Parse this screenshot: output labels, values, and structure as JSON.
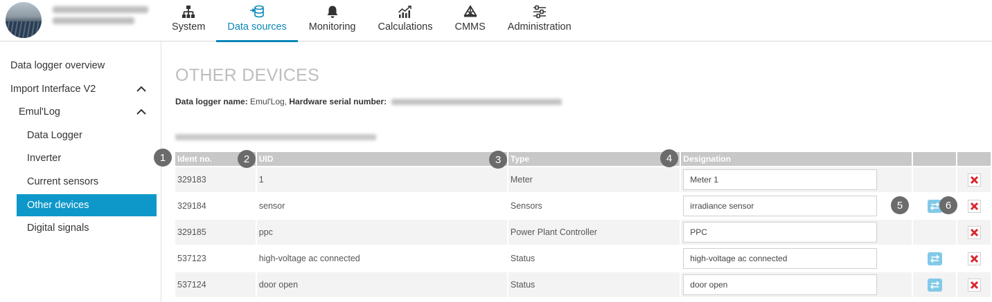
{
  "header": {
    "nav": [
      {
        "label": "System",
        "icon": "sitemap-icon"
      },
      {
        "label": "Data sources",
        "icon": "data-sources-icon",
        "active": true
      },
      {
        "label": "Monitoring",
        "icon": "bell-icon"
      },
      {
        "label": "Calculations",
        "icon": "chart-icon"
      },
      {
        "label": "CMMS",
        "icon": "tools-icon"
      },
      {
        "label": "Administration",
        "icon": "sliders-icon"
      }
    ]
  },
  "sidebar": {
    "items": [
      {
        "label": "Data logger overview"
      },
      {
        "label": "Import Interface V2",
        "expanded": true
      },
      {
        "label": "Emul'Log",
        "expanded": true
      },
      {
        "label": "Data Logger"
      },
      {
        "label": "Inverter"
      },
      {
        "label": "Current sensors"
      },
      {
        "label": "Other devices",
        "active": true
      },
      {
        "label": "Digital signals"
      }
    ]
  },
  "main": {
    "title": "OTHER DEVICES",
    "logger_name_label": "Data logger name:",
    "logger_name": "Emul'Log,",
    "serial_label": "Hardware serial number:",
    "table": {
      "columns": [
        "Ident no.",
        "UID",
        "Type",
        "Designation"
      ],
      "rows": [
        {
          "ident": "329183",
          "uid": "1",
          "type": "Meter",
          "designation": "Meter 1",
          "swap": false
        },
        {
          "ident": "329184",
          "uid": "sensor",
          "type": "Sensors",
          "designation": "irradiance sensor",
          "swap": true
        },
        {
          "ident": "329185",
          "uid": "ppc",
          "type": "Power Plant Controller",
          "designation": "PPC",
          "swap": false
        },
        {
          "ident": "537123",
          "uid": "high-voltage ac connected",
          "type": "Status",
          "designation": "high-voltage ac connected",
          "swap": true
        },
        {
          "ident": "537124",
          "uid": "door open",
          "type": "Status",
          "designation": "door open",
          "swap": true
        }
      ]
    }
  },
  "callouts": [
    "1",
    "2",
    "3",
    "4",
    "5",
    "6"
  ],
  "colors": {
    "accent": "#0a86b8",
    "sidebar_active": "#0e98c9",
    "header_gray": "#c8c8c8",
    "delete_red": "#d9262c",
    "swap_blue": "#82c9e8"
  }
}
